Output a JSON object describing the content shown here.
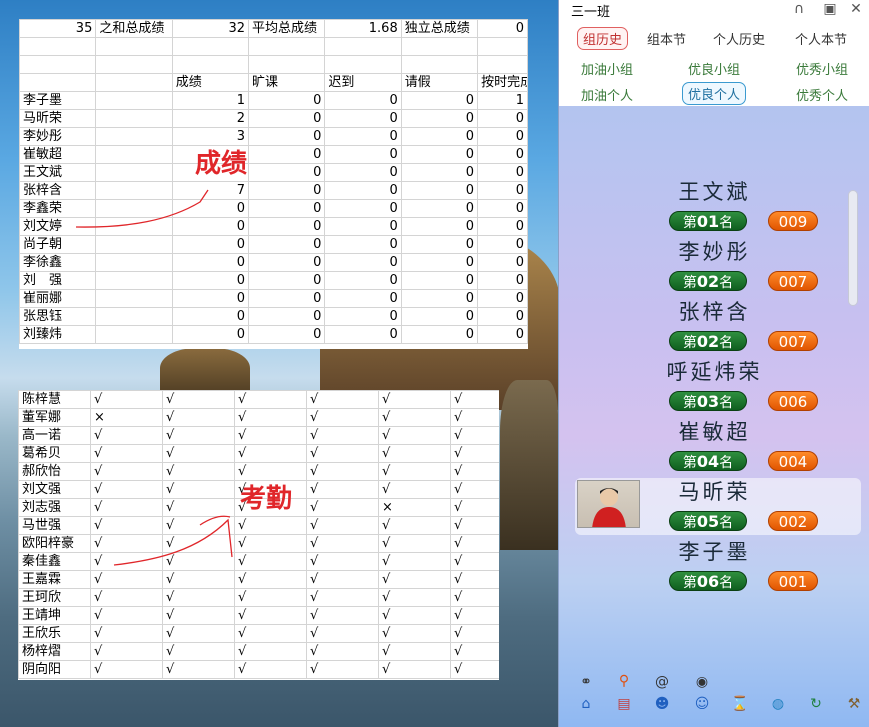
{
  "sheet1": {
    "top_row": [
      "35",
      "之和总成绩",
      "32",
      "平均总成绩",
      "1.68",
      "独立总成绩",
      "0"
    ],
    "headers": [
      "",
      "成绩",
      "旷课",
      "迟到",
      "请假",
      "按时完成"
    ],
    "rows": [
      {
        "name": "李子墨",
        "vals": [
          "1",
          "0",
          "0",
          "0",
          "1"
        ]
      },
      {
        "name": "马昕荣",
        "vals": [
          "2",
          "0",
          "0",
          "0",
          "0"
        ]
      },
      {
        "name": "李妙彤",
        "vals": [
          "3",
          "0",
          "0",
          "0",
          "0"
        ]
      },
      {
        "name": "崔敏超",
        "vals": [
          "",
          "0",
          "0",
          "0",
          "0"
        ]
      },
      {
        "name": "王文斌",
        "vals": [
          "",
          "0",
          "0",
          "0",
          "0"
        ]
      },
      {
        "name": "张梓含",
        "vals": [
          "7",
          "0",
          "0",
          "0",
          "0"
        ]
      },
      {
        "name": "李鑫荣",
        "vals": [
          "0",
          "0",
          "0",
          "0",
          "0"
        ]
      },
      {
        "name": "刘文婷",
        "vals": [
          "0",
          "0",
          "0",
          "0",
          "0"
        ]
      },
      {
        "name": "尚子朝",
        "vals": [
          "0",
          "0",
          "0",
          "0",
          "0"
        ]
      },
      {
        "name": "李徐鑫",
        "vals": [
          "0",
          "0",
          "0",
          "0",
          "0"
        ]
      },
      {
        "name": "刘　强",
        "vals": [
          "0",
          "0",
          "0",
          "0",
          "0"
        ]
      },
      {
        "name": "崔丽娜",
        "vals": [
          "0",
          "0",
          "0",
          "0",
          "0"
        ]
      },
      {
        "name": "张思钰",
        "vals": [
          "0",
          "0",
          "0",
          "0",
          "0"
        ]
      },
      {
        "name": "刘臻炜",
        "vals": [
          "0",
          "0",
          "0",
          "0",
          "0"
        ]
      }
    ],
    "annotation": "成绩"
  },
  "sheet2": {
    "rows": [
      {
        "name": "陈梓慧",
        "marks": [
          "√",
          "√",
          "√",
          "√",
          "√",
          "√"
        ]
      },
      {
        "name": "董军娜",
        "marks": [
          "×",
          "√",
          "√",
          "√",
          "√",
          "√"
        ]
      },
      {
        "name": "高一诺",
        "marks": [
          "√",
          "√",
          "√",
          "√",
          "√",
          "√"
        ]
      },
      {
        "name": "葛希贝",
        "marks": [
          "√",
          "√",
          "√",
          "√",
          "√",
          "√"
        ]
      },
      {
        "name": "郝欣怡",
        "marks": [
          "√",
          "√",
          "√",
          "√",
          "√",
          "√"
        ]
      },
      {
        "name": "刘文强",
        "marks": [
          "√",
          "√",
          "√",
          "√",
          "√",
          "√"
        ]
      },
      {
        "name": "刘志强",
        "marks": [
          "√",
          "√",
          "√",
          "√",
          "×",
          "√"
        ]
      },
      {
        "name": "马世强",
        "marks": [
          "√",
          "√",
          "√",
          "√",
          "√",
          "√"
        ]
      },
      {
        "name": "欧阳梓豪",
        "marks": [
          "√",
          "√",
          "√",
          "√",
          "√",
          "√"
        ]
      },
      {
        "name": "秦佳鑫",
        "marks": [
          "√",
          "√",
          "√",
          "√",
          "√",
          "√"
        ]
      },
      {
        "name": "王嘉霖",
        "marks": [
          "√",
          "√",
          "√",
          "√",
          "√",
          "√"
        ]
      },
      {
        "name": "王珂欣",
        "marks": [
          "√",
          "√",
          "√",
          "√",
          "√",
          "√"
        ]
      },
      {
        "name": "王靖坤",
        "marks": [
          "√",
          "√",
          "√",
          "√",
          "√",
          "√"
        ]
      },
      {
        "name": "王欣乐",
        "marks": [
          "√",
          "√",
          "√",
          "√",
          "√",
          "√"
        ]
      },
      {
        "name": "杨梓熠",
        "marks": [
          "√",
          "√",
          "√",
          "√",
          "√",
          "√"
        ]
      },
      {
        "name": "阴向阳",
        "marks": [
          "√",
          "√",
          "√",
          "√",
          "√",
          "√"
        ]
      }
    ],
    "annotation": "考勤"
  },
  "panel": {
    "title": "三一班",
    "menu_row1": [
      "组历史",
      "组本节",
      "个人历史",
      "个人本节"
    ],
    "menu_row2": [
      "加油小组",
      "优良小组",
      "优秀小组"
    ],
    "menu_row3": [
      "加油个人",
      "优良个人",
      "优秀个人"
    ],
    "ranking": [
      {
        "name": "王文斌",
        "rank_prefix": "第",
        "rank": "01",
        "rank_suffix": "名",
        "score": "009"
      },
      {
        "name": "李妙彤",
        "rank_prefix": "第",
        "rank": "02",
        "rank_suffix": "名",
        "score": "007"
      },
      {
        "name": "张梓含",
        "rank_prefix": "第",
        "rank": "02",
        "rank_suffix": "名",
        "score": "007"
      },
      {
        "name": "呼延炜荣",
        "rank_prefix": "第",
        "rank": "03",
        "rank_suffix": "名",
        "score": "006"
      },
      {
        "name": "崔敏超",
        "rank_prefix": "第",
        "rank": "04",
        "rank_suffix": "名",
        "score": "004"
      },
      {
        "name": "马昕荣",
        "rank_prefix": "第",
        "rank": "05",
        "rank_suffix": "名",
        "score": "002"
      },
      {
        "name": "李子墨",
        "rank_prefix": "第",
        "rank": "06",
        "rank_suffix": "名",
        "score": "001"
      }
    ],
    "toolbar_icons": [
      "link-icon",
      "search-icon",
      "at-icon",
      "eye-icon",
      "home-icon",
      "card-icon",
      "group-icon",
      "smile-icon",
      "hourglass-icon",
      "globe-icon",
      "refresh-icon",
      "tools-icon"
    ]
  }
}
